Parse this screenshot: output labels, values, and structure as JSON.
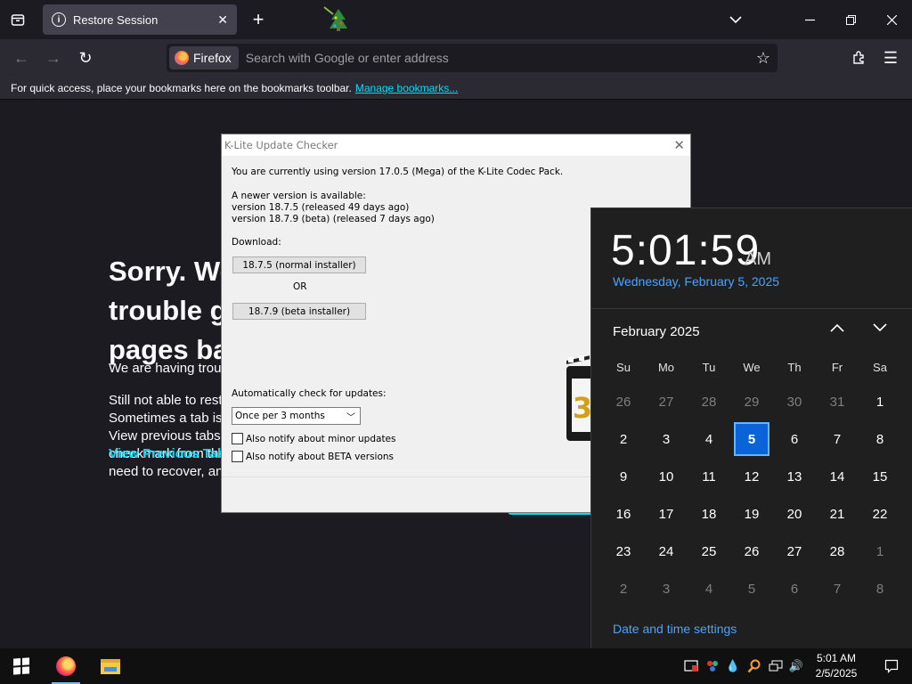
{
  "browser": {
    "tab": {
      "title": "Restore Session",
      "icon": "info-icon"
    },
    "url_identity": "Firefox",
    "url_placeholder": "Search with Google or enter address",
    "bookmarks_bar": {
      "text": "For quick access, place your bookmarks here on the bookmarks toolbar.",
      "link": "Manage bookmarks..."
    }
  },
  "page": {
    "title": "Sorry. We're having trouble getting your pages back.",
    "p1": "We are having trouble restoring your last browsing session.",
    "p2": "Still not able to restore your session? Sometimes a tab is causing the issue. View previous tabs, remove the checkmark from the tabs you don't need to recover, and then restore.",
    "view_tabs_link": "View Previous Tabs"
  },
  "klite": {
    "title": "K-Lite Update Checker",
    "current_version": "You are currently using version 17.0.5 (Mega) of the K-Lite Codec Pack.",
    "newer_available": "A newer version is available:",
    "version_line1": "version 18.7.5  (released 49 days ago)",
    "version_line2": "version 18.7.9  (beta)  (released 7 days ago)",
    "download_label": "Download:",
    "btn_normal": "18.7.5 (normal installer)",
    "or_label": "OR",
    "btn_beta": "18.7.9 (beta installer)",
    "auto_check_label": "Automatically check for updates:",
    "auto_check_value": "Once per 3 months",
    "check_minor": "Also notify about minor updates",
    "check_beta": "Also notify about BETA versions"
  },
  "clock": {
    "time": "5:01:59",
    "ampm": "AM",
    "date": "Wednesday, February 5, 2025",
    "month_label": "February 2025",
    "weekdays": [
      "Su",
      "Mo",
      "Tu",
      "We",
      "Th",
      "Fr",
      "Sa"
    ],
    "weeks": [
      [
        [
          "26",
          true
        ],
        [
          "27",
          true
        ],
        [
          "28",
          true
        ],
        [
          "29",
          true
        ],
        [
          "30",
          true
        ],
        [
          "31",
          true
        ],
        [
          "1",
          false
        ]
      ],
      [
        [
          "2",
          false
        ],
        [
          "3",
          false
        ],
        [
          "4",
          false
        ],
        [
          "5",
          false
        ],
        [
          "6",
          false
        ],
        [
          "7",
          false
        ],
        [
          "8",
          false
        ]
      ],
      [
        [
          "9",
          false
        ],
        [
          "10",
          false
        ],
        [
          "11",
          false
        ],
        [
          "12",
          false
        ],
        [
          "13",
          false
        ],
        [
          "14",
          false
        ],
        [
          "15",
          false
        ]
      ],
      [
        [
          "16",
          false
        ],
        [
          "17",
          false
        ],
        [
          "18",
          false
        ],
        [
          "19",
          false
        ],
        [
          "20",
          false
        ],
        [
          "21",
          false
        ],
        [
          "22",
          false
        ]
      ],
      [
        [
          "23",
          false
        ],
        [
          "24",
          false
        ],
        [
          "25",
          false
        ],
        [
          "26",
          false
        ],
        [
          "27",
          false
        ],
        [
          "28",
          false
        ],
        [
          "1",
          true
        ]
      ],
      [
        [
          "2",
          true
        ],
        [
          "3",
          true
        ],
        [
          "4",
          true
        ],
        [
          "5",
          true
        ],
        [
          "6",
          true
        ],
        [
          "7",
          true
        ],
        [
          "8",
          true
        ]
      ]
    ],
    "today": "5",
    "settings_link": "Date and time settings"
  },
  "taskbar": {
    "time": "5:01 AM",
    "date": "2/5/2025"
  },
  "colors": {
    "accent_link": "#00ddff",
    "windows_accent": "#0a64d8",
    "calendar_link": "#4aa3ff"
  }
}
